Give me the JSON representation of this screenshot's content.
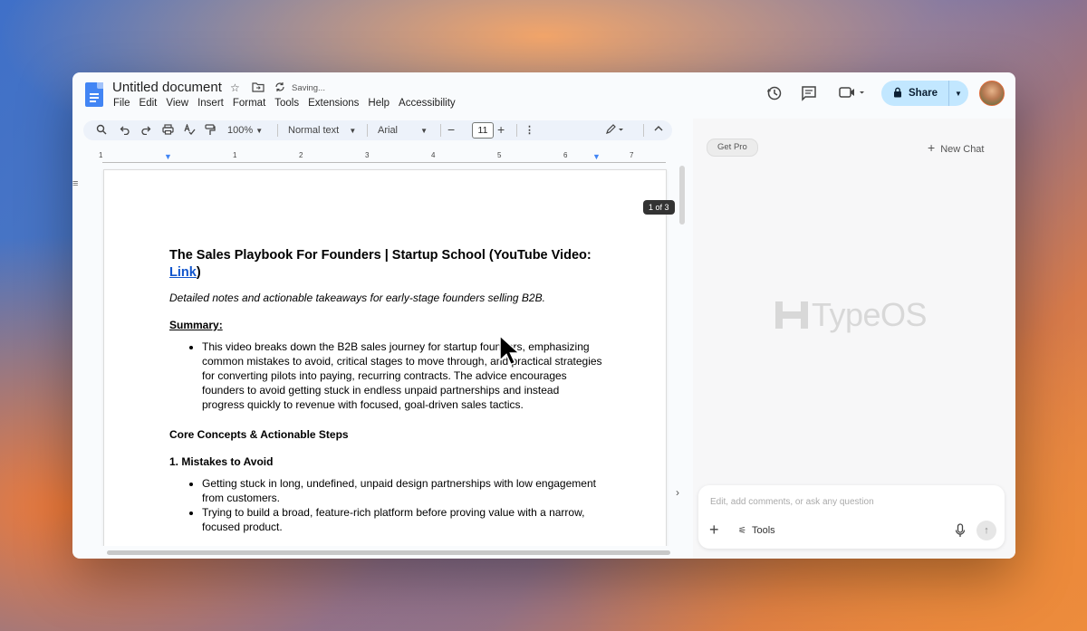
{
  "app": {
    "doc_title": "Untitled document",
    "save_status": "Saving...",
    "menu": [
      "File",
      "Edit",
      "View",
      "Insert",
      "Format",
      "Tools",
      "Extensions",
      "Help",
      "Accessibility"
    ],
    "share_label": "Share"
  },
  "toolbar": {
    "zoom": "100%",
    "style": "Normal text",
    "font": "Arial",
    "font_size": "11"
  },
  "ruler": {
    "numbers": [
      "1",
      "1",
      "2",
      "3",
      "4",
      "5",
      "6",
      "7"
    ]
  },
  "document": {
    "page_indicator": "1 of 3",
    "heading": "The Sales Playbook For Founders | Startup School (YouTube Video: ",
    "heading_link": "Link",
    "heading_end": ")",
    "subtitle": "Detailed notes and actionable takeaways for early-stage founders selling B2B.",
    "summary_heading": "Summary:",
    "summary_bullets": [
      "This video breaks down the B2B sales journey for startup founders, emphasizing common mistakes to avoid, critical stages to move through, and practical strategies for converting pilots into paying, recurring contracts. The advice encourages founders to avoid getting stuck in endless unpaid partnerships and instead progress quickly to revenue with focused, goal-driven sales tactics."
    ],
    "core_heading": "Core Concepts & Actionable Steps",
    "mistakes_heading": "1. Mistakes to Avoid",
    "mistakes_bullets": [
      "Getting stuck in long, undefined, unpaid design partnerships with low engagement from customers.",
      "Trying to build a broad, feature-rich platform before proving value with a narrow, focused product."
    ]
  },
  "sidebar": {
    "get_pro": "Get Pro",
    "new_chat": "New Chat",
    "brand": "TypeOS",
    "chat_placeholder": "Edit, add comments, or ask any question",
    "tools_label": "Tools"
  },
  "colors": {
    "share_bg": "#c2e7ff",
    "docs_blue": "#4285f4",
    "link": "#1155cc"
  }
}
